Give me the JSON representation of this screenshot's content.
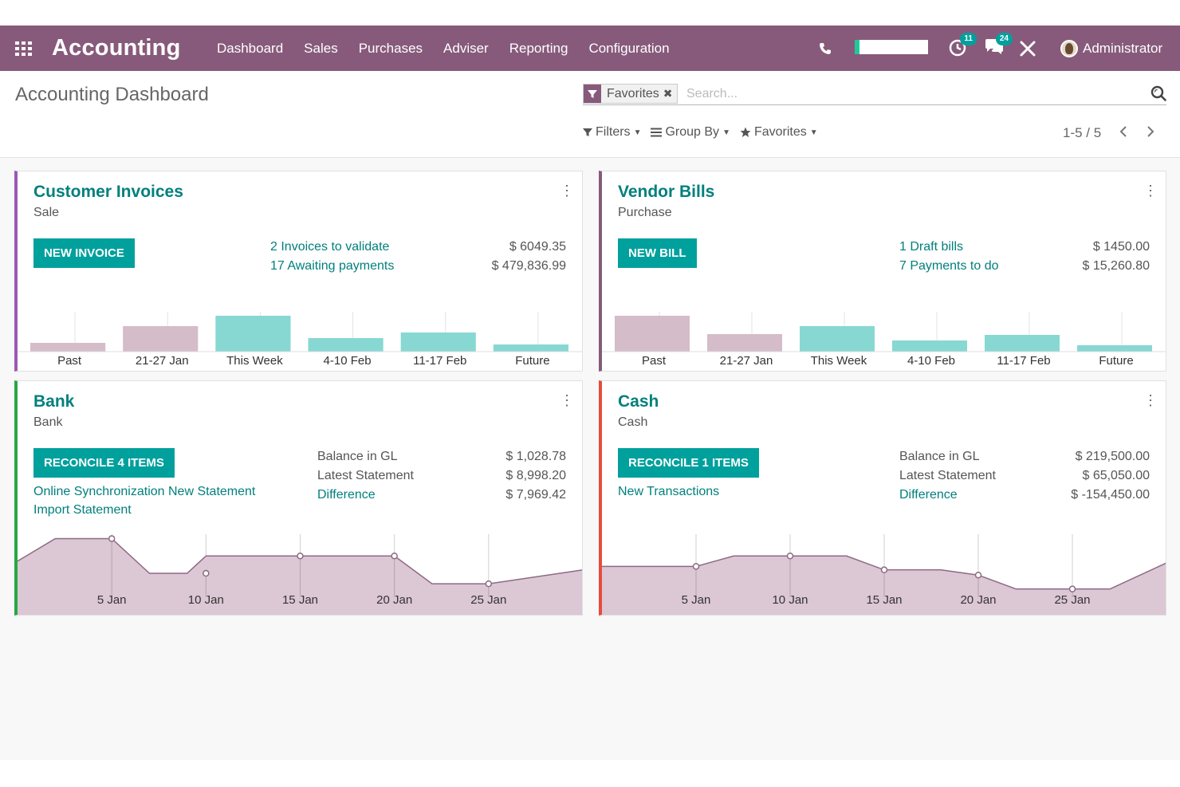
{
  "navbar": {
    "brand": "Accounting",
    "menu": [
      "Dashboard",
      "Sales",
      "Purchases",
      "Adviser",
      "Reporting",
      "Configuration"
    ],
    "activity_badge": "11",
    "messages_badge": "24",
    "user": "Administrator",
    "icons": [
      "apps-grid-icon",
      "phone-icon",
      "activity-clock-icon",
      "chat-icon",
      "tools-icon",
      "avatar"
    ]
  },
  "control": {
    "title": "Accounting Dashboard",
    "facet_label": "Favorites",
    "search_placeholder": "Search...",
    "filters": "Filters",
    "group_by": "Group By",
    "favorites": "Favorites",
    "pager": "1-5 / 5"
  },
  "colors": {
    "navbar": "#875a7b",
    "primary": "#00a09d",
    "link": "#00807d",
    "sale_border": "#9b59b6",
    "purchase_border": "#875a7b",
    "bank_border": "#28a745",
    "cash_border": "#e74c3c",
    "bar_past": "#d5bcc9",
    "bar_future": "#87d8d3",
    "area_fill": "#dcc7d4"
  },
  "cards": {
    "sale": {
      "title": "Customer Invoices",
      "subtitle": "Sale",
      "button": "NEW INVOICE",
      "links": [
        "2 Invoices to validate",
        "17 Awaiting payments"
      ],
      "amounts": [
        "$ 6049.35",
        "$ 479,836.99"
      ]
    },
    "purchase": {
      "title": "Vendor Bills",
      "subtitle": "Purchase",
      "button": "NEW BILL",
      "links": [
        "1 Draft bills",
        "7 Payments to do"
      ],
      "amounts": [
        "$ 1450.00",
        "$ 15,260.80"
      ]
    },
    "bank": {
      "title": "Bank",
      "subtitle": "Bank",
      "button": "RECONCILE 4 ITEMS",
      "links": [
        "Online Synchronization New Statement",
        "Import Statement"
      ],
      "labels": [
        "Balance in GL",
        "Latest Statement"
      ],
      "difference": "Difference",
      "amounts": [
        "$ 1,028.78",
        "$ 8,998.20",
        "$ 7,969.42"
      ]
    },
    "cash": {
      "title": "Cash",
      "subtitle": "Cash",
      "button": "RECONCILE 1 ITEMS",
      "links": [
        "New Transactions"
      ],
      "labels": [
        "Balance in GL",
        "Latest Statement"
      ],
      "difference": "Difference",
      "amounts": [
        "$ 219,500.00",
        "$ 65,050.00",
        "$ -154,450.00"
      ]
    }
  },
  "chart_data": [
    {
      "type": "bar",
      "name": "sale",
      "categories": [
        "Past",
        "21-27 Jan",
        "This Week",
        "4-10 Feb",
        "11-17 Feb",
        "Future"
      ],
      "values": [
        11,
        32,
        45,
        17,
        24,
        9
      ],
      "bar_colors": [
        "#d5bcc9",
        "#d5bcc9",
        "#87d8d3",
        "#87d8d3",
        "#87d8d3",
        "#87d8d3"
      ],
      "ylim": [
        0,
        48
      ]
    },
    {
      "type": "bar",
      "name": "purchase",
      "categories": [
        "Past",
        "21-27 Jan",
        "This Week",
        "4-10 Feb",
        "11-17 Feb",
        "Future"
      ],
      "values": [
        45,
        22,
        32,
        14,
        21,
        8
      ],
      "bar_colors": [
        "#d5bcc9",
        "#d5bcc9",
        "#87d8d3",
        "#87d8d3",
        "#87d8d3",
        "#87d8d3"
      ],
      "ylim": [
        0,
        48
      ]
    },
    {
      "type": "area",
      "name": "bank",
      "x_ticks": [
        "5 Jan",
        "10 Jan",
        "15 Jan",
        "20 Jan",
        "25 Jan"
      ],
      "x": [
        0,
        2,
        5,
        7,
        9,
        10,
        12,
        15,
        20,
        22,
        23,
        25,
        30
      ],
      "values": [
        29,
        42,
        42,
        22,
        22,
        32,
        32,
        32,
        32,
        16,
        16,
        16,
        24
      ],
      "markers": [
        {
          "x": 5,
          "y": 42
        },
        {
          "x": 10,
          "y": 22
        },
        {
          "x": 15,
          "y": 32
        },
        {
          "x": 20,
          "y": 32
        },
        {
          "x": 25,
          "y": 16
        }
      ],
      "xlim": [
        0,
        30
      ],
      "ylim": [
        0,
        50
      ]
    },
    {
      "type": "area",
      "name": "cash",
      "x_ticks": [
        "5 Jan",
        "10 Jan",
        "15 Jan",
        "20 Jan",
        "25 Jan"
      ],
      "x": [
        0,
        5,
        7,
        10,
        13,
        15,
        18,
        20,
        22,
        25,
        27,
        30
      ],
      "values": [
        26,
        26,
        32,
        32,
        32,
        24,
        24,
        21,
        13,
        13,
        13,
        28
      ],
      "markers": [
        {
          "x": 5,
          "y": 26
        },
        {
          "x": 10,
          "y": 32
        },
        {
          "x": 15,
          "y": 24
        },
        {
          "x": 20,
          "y": 21
        },
        {
          "x": 25,
          "y": 13
        }
      ],
      "xlim": [
        0,
        30
      ],
      "ylim": [
        0,
        50
      ]
    }
  ]
}
